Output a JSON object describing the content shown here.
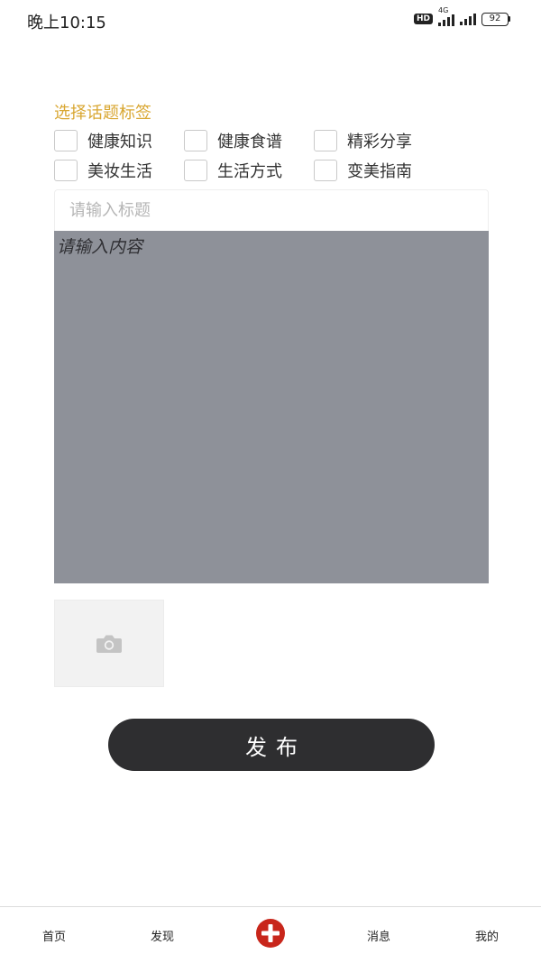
{
  "status_bar": {
    "time": "晚上10:15",
    "hd": "HD",
    "network": "4G",
    "battery": "92"
  },
  "topics": {
    "title": "选择话题标签",
    "tags": [
      {
        "label": "健康知识",
        "checked": false
      },
      {
        "label": "健康食谱",
        "checked": false
      },
      {
        "label": "精彩分享",
        "checked": false
      },
      {
        "label": "美妆生活",
        "checked": false
      },
      {
        "label": "生活方式",
        "checked": false
      },
      {
        "label": "变美指南",
        "checked": false
      }
    ]
  },
  "form": {
    "title_placeholder": "请输入标题",
    "title_value": "",
    "content_placeholder": "请输入内容",
    "content_value": "",
    "upload_icon": "camera-icon",
    "publish_label": "发布"
  },
  "tab_bar": {
    "items": [
      {
        "label": "首页"
      },
      {
        "label": "发现"
      },
      {
        "label": "",
        "icon": "add-circle-icon"
      },
      {
        "label": "消息"
      },
      {
        "label": "我的"
      }
    ]
  },
  "colors": {
    "accent_title": "#d9a732",
    "content_bg": "#8e9199",
    "publish_bg": "#2e2e30",
    "add_icon": "#c8261b"
  }
}
